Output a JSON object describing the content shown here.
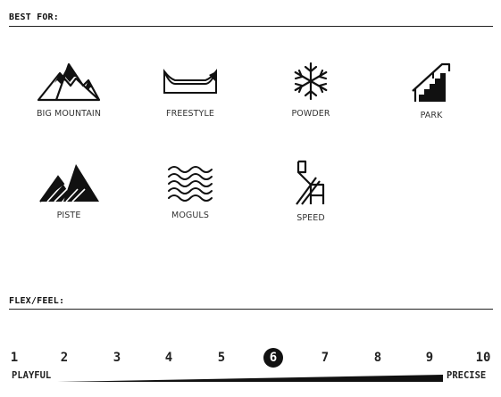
{
  "best_for": {
    "title": "BEST FOR:",
    "items": [
      {
        "label": "BIG MOUNTAIN",
        "icon": "big-mountain-icon"
      },
      {
        "label": "FREESTYLE",
        "icon": "freestyle-icon"
      },
      {
        "label": "POWDER",
        "icon": "snowflake-icon"
      },
      {
        "label": "PARK",
        "icon": "park-rail-icon"
      },
      {
        "label": "PISTE",
        "icon": "piste-icon"
      },
      {
        "label": "MOGULS",
        "icon": "moguls-icon"
      },
      {
        "label": "SPEED",
        "icon": "speed-icon"
      }
    ]
  },
  "flex_feel": {
    "title": "FLEX/FEEL:",
    "scale": [
      "1",
      "2",
      "3",
      "4",
      "5",
      "6",
      "7",
      "8",
      "9",
      "10"
    ],
    "selected": "6",
    "low_label": "PLAYFUL",
    "high_label": "PRECISE"
  }
}
